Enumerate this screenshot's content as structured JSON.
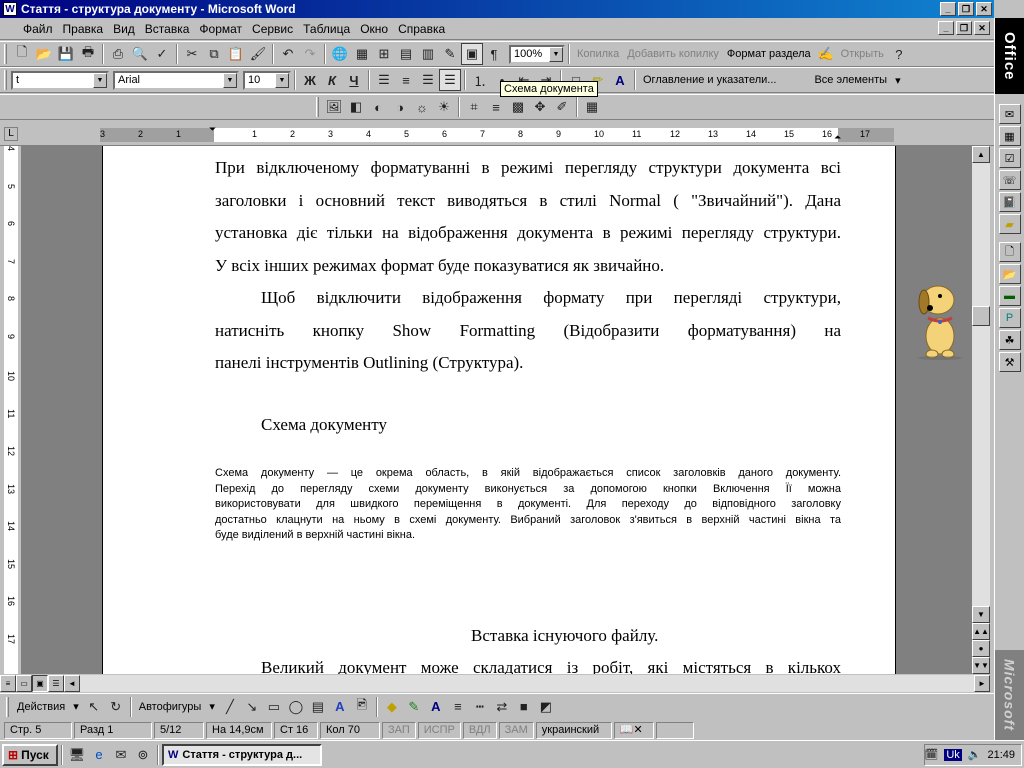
{
  "window": {
    "title": "Стаття - структура документу - Microsoft Word",
    "icon": "word-icon"
  },
  "menu": [
    "Файл",
    "Правка",
    "Вид",
    "Вставка",
    "Формат",
    "Сервис",
    "Таблица",
    "Окно",
    "Справка"
  ],
  "standard_toolbar": {
    "zoom": "100%",
    "copy_label": "Копилка",
    "add_copy_label": "Добавить копилку",
    "section_format_label": "Формат раздела",
    "open_label": "Открыть"
  },
  "format_toolbar": {
    "style": "t",
    "font": "Arial",
    "size": "10",
    "bold": "Ж",
    "italic": "К",
    "underline": "Ч",
    "toc_label": "Оглавление и указатели...",
    "all_elements_label": "Все элементы"
  },
  "tooltip": "Схема документа",
  "ruler": {
    "h_ticks": [
      "3",
      "2",
      "1",
      "1",
      "2",
      "3",
      "4",
      "5",
      "6",
      "7",
      "8",
      "9",
      "10",
      "11",
      "12",
      "13",
      "14",
      "15",
      "16",
      "17"
    ],
    "v_ticks": [
      "4",
      "5",
      "6",
      "7",
      "8",
      "9",
      "10",
      "11",
      "12",
      "13",
      "14",
      "15",
      "16",
      "17"
    ]
  },
  "document": {
    "p1_lines": [
      "При відключеному форматуванні в режимі перегляду структури документа всі",
      "заголовки і основний текст виводяться в стилі  Normal ( \"Звичайний\"). Дана",
      "установка діє тільки на відображення документа в режимі перегляду структури.",
      "У всіх інших режимах формат буде показуватися як звичайно."
    ],
    "p2_lines": [
      "Щоб відключити відображення формату при перегляді структури,",
      "натисніть кнопку Show Formatting (Відобразити форматування) на",
      "панелі інструментів Outlining (Структура)."
    ],
    "heading1": "Схема документу",
    "small_lines": [
      "Схема документу — це окрема область, в якій відображається список заголовків даного документу.",
      "Перехід до перегляду схеми документу виконується за допомогою кнопки Включення  Її можна",
      "використовувати для швидкого переміщення в документі. Для переходу до відповідного заголовку",
      "достатньо клацнути на ньому в схемі документу. Вибраний заголовок з'явиться в верхній частині вікна та",
      "буде виділений в верхній частині вікна."
    ],
    "heading2": "Вставка існуючого файлу.",
    "p3_line": "Великий документ може складатися із робіт, які містяться в кількох"
  },
  "drawing_toolbar": {
    "actions": "Действия",
    "autoshapes": "Автофигуры"
  },
  "status": {
    "page": "Стр. 5",
    "section": "Разд 1",
    "pages": "5/12",
    "at": "На 14,9см",
    "line": "Ст 16",
    "col": "Кол 70",
    "rec": "ЗАП",
    "trk": "ИСПР",
    "ext": "ВДЛ",
    "ovr": "ЗАМ",
    "lang": "украинский"
  },
  "taskbar": {
    "start": "Пуск",
    "task": "Стаття - структура д...",
    "lang": "Uk",
    "time": "21:49"
  },
  "office_bar": {
    "title": "Office",
    "footer": "Microsoft"
  }
}
